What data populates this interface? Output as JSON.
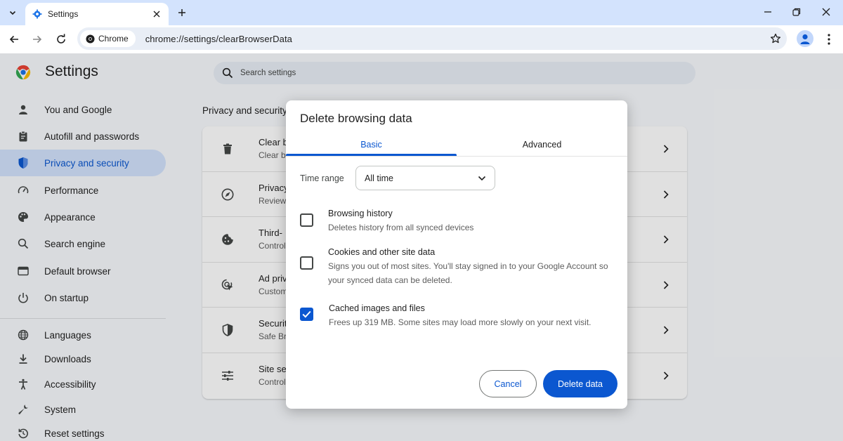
{
  "browser": {
    "tab_title": "Settings",
    "chip_label": "Chrome",
    "url": "chrome://settings/clearBrowserData"
  },
  "settings": {
    "page_title": "Settings",
    "search_placeholder": "Search settings",
    "sidebar": [
      {
        "label": "You and Google",
        "icon": "person-icon"
      },
      {
        "label": "Autofill and passwords",
        "icon": "clipboard-icon"
      },
      {
        "label": "Privacy and security",
        "icon": "shield-icon",
        "active": true
      },
      {
        "label": "Performance",
        "icon": "speedometer-icon"
      },
      {
        "label": "Appearance",
        "icon": "palette-icon"
      },
      {
        "label": "Search engine",
        "icon": "search-icon"
      },
      {
        "label": "Default browser",
        "icon": "browser-window-icon"
      },
      {
        "label": "On startup",
        "icon": "power-icon"
      },
      {
        "label": "Languages",
        "icon": "globe-icon"
      },
      {
        "label": "Downloads",
        "icon": "download-icon"
      },
      {
        "label": "Accessibility",
        "icon": "accessibility-icon"
      },
      {
        "label": "System",
        "icon": "wrench-icon"
      },
      {
        "label": "Reset settings",
        "icon": "reset-icon"
      }
    ],
    "section_title": "Privacy and security",
    "rows": [
      {
        "title": "Clear b",
        "subtitle": "Clear b",
        "icon": "trash-icon"
      },
      {
        "title": "Privacy",
        "subtitle": "Review",
        "icon": "compass-icon"
      },
      {
        "title": "Third-",
        "subtitle": "Control",
        "icon": "cookie-icon"
      },
      {
        "title": "Ad priv",
        "subtitle": "Custom",
        "icon": "ad-privacy-icon"
      },
      {
        "title": "Securit",
        "subtitle": "Safe Br",
        "icon": "security-shield-icon"
      },
      {
        "title": "Site se",
        "subtitle": "Control",
        "icon": "sliders-icon"
      }
    ]
  },
  "dialog": {
    "title": "Delete browsing data",
    "tabs": [
      "Basic",
      "Advanced"
    ],
    "active_tab": "Basic",
    "time_range_label": "Time range",
    "time_range_value": "All time",
    "options": [
      {
        "title": "Browsing history",
        "description": "Deletes history from all synced devices",
        "checked": false
      },
      {
        "title": "Cookies and other site data",
        "description": "Signs you out of most sites. You'll stay signed in to your Google Account so your synced data can be deleted.",
        "checked": false
      },
      {
        "title": "Cached images and files",
        "description": "Frees up 319 MB. Some sites may load more slowly on your next visit.",
        "checked": true
      }
    ],
    "cancel_label": "Cancel",
    "confirm_label": "Delete data"
  },
  "colors": {
    "accent": "#0b57d0",
    "tabstrip": "#d3e3fd",
    "active_nav_bg": "#d3e3fd",
    "page_bg": "#f8fafd"
  }
}
